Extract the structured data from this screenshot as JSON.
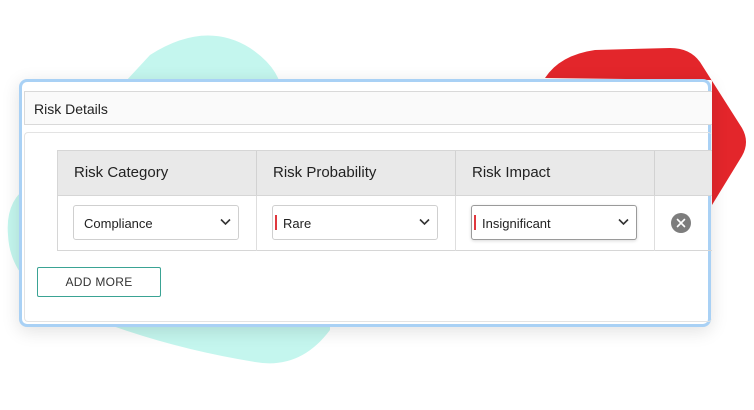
{
  "section": {
    "title": "Risk Details"
  },
  "table": {
    "headers": [
      "Risk Category",
      "Risk Probability",
      "Risk Impact",
      ""
    ],
    "rows": [
      {
        "category": "Compliance",
        "probability": "Rare",
        "impact": "Insignificant"
      }
    ]
  },
  "required_fields": [
    "Risk Probability",
    "Risk Impact"
  ],
  "actions": {
    "add_more_label": "ADD MORE"
  },
  "icons": {
    "dropdown": "chevron-down-icon",
    "remove": "close-circle-icon"
  },
  "colors": {
    "card_border": "#a9d1f5",
    "header_bg": "#e9e9e9",
    "add_more_border": "#3aa394",
    "required_marker": "#e0383e",
    "backdrop_teal": "#c4f6ee",
    "backdrop_red": "#e3262b"
  }
}
